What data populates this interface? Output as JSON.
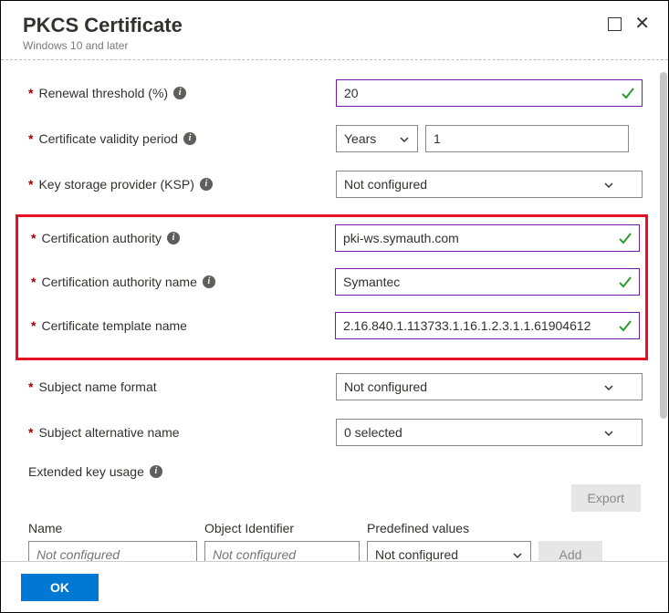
{
  "header": {
    "title": "PKCS Certificate",
    "subtitle": "Windows 10 and later"
  },
  "fields": {
    "renewal_threshold": {
      "label": "Renewal threshold (%)",
      "value": "20"
    },
    "validity_period": {
      "label": "Certificate validity period",
      "unit": "Years",
      "value": "1"
    },
    "ksp": {
      "label": "Key storage provider (KSP)",
      "value": "Not configured"
    },
    "ca": {
      "label": "Certification authority",
      "value": "pki-ws.symauth.com"
    },
    "ca_name": {
      "label": "Certification authority name",
      "value": "Symantec"
    },
    "template_name": {
      "label": "Certificate template name",
      "value": "2.16.840.1.113733.1.16.1.2.3.1.1.61904612"
    },
    "subject_format": {
      "label": "Subject name format",
      "value": "Not configured"
    },
    "san": {
      "label": "Subject alternative name",
      "value": "0 selected"
    },
    "eku": {
      "label": "Extended key usage",
      "export_btn": "Export",
      "add_btn": "Add",
      "columns": {
        "name": "Name",
        "oid": "Object Identifier",
        "predef": "Predefined values"
      },
      "placeholders": {
        "name": "Not configured",
        "oid": "Not configured",
        "predef": "Not configured"
      }
    }
  },
  "footer": {
    "ok": "OK"
  }
}
